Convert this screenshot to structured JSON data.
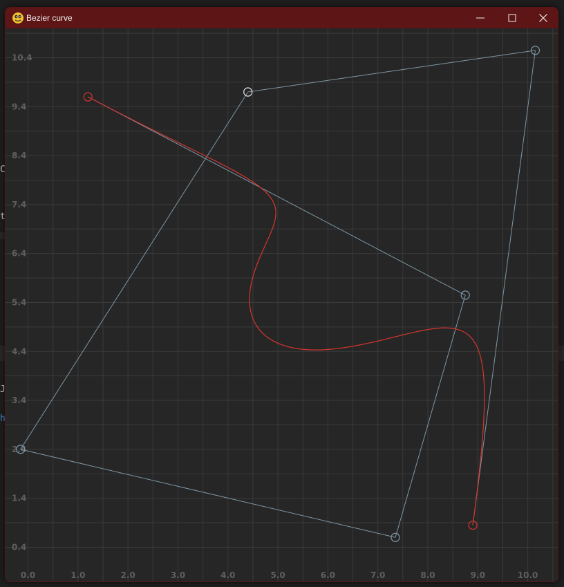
{
  "window": {
    "title": "Bezier curve",
    "icon": "python-snake-icon",
    "controls": [
      "minimize-icon",
      "maximize-icon",
      "close-icon"
    ],
    "titlebar_color": "#5e1515"
  },
  "background": {
    "fragments": [
      "C",
      "t",
      "J",
      "h"
    ]
  },
  "chart_data": {
    "type": "line",
    "title": "",
    "xlabel": "",
    "ylabel": "",
    "xlim": [
      -0.45,
      10.6
    ],
    "ylim": [
      -0.3,
      11.0
    ],
    "grid": true,
    "x_ticks": [
      "0.0",
      "1.0",
      "2.0",
      "3.0",
      "4.0",
      "5.0",
      "6.0",
      "7.0",
      "8.0",
      "9.0",
      "10.0"
    ],
    "y_ticks": [
      "0.4",
      "1.4",
      "2.4",
      "3.4",
      "4.4",
      "5.4",
      "6.4",
      "7.4",
      "8.4",
      "9.4",
      "10.4"
    ],
    "control_points": [
      {
        "x": 1.2,
        "y": 9.6
      },
      {
        "x": 8.75,
        "y": 5.55
      },
      {
        "x": 4.4,
        "y": 9.7
      },
      {
        "x": -0.15,
        "y": 2.4
      },
      {
        "x": 7.35,
        "y": 0.6
      },
      {
        "x": 10.15,
        "y": 10.55
      },
      {
        "x": 8.9,
        "y": 0.85
      }
    ],
    "control_polygon_order": [
      0,
      1,
      4,
      3,
      2,
      5,
      6
    ],
    "active_point": 2,
    "curve_color": "#d6362e",
    "polygon_color": "#7f97a6",
    "grid_color": "#3a3a3a",
    "background_color": "#262626",
    "tick_color": "#5f5f5f"
  }
}
